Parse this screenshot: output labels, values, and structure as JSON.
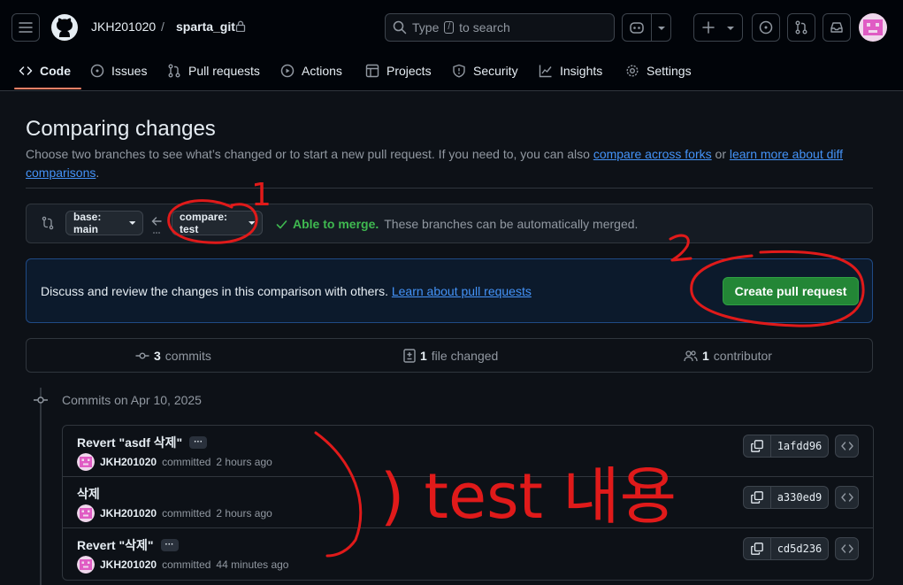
{
  "header": {
    "owner": "JKH201020",
    "separator": "/",
    "repo": "sparta_git",
    "search": {
      "prefix": "Type",
      "key": "/",
      "suffix": "to search"
    }
  },
  "tabs": [
    {
      "label": "Code",
      "icon": "code-icon"
    },
    {
      "label": "Issues",
      "icon": "issue-icon"
    },
    {
      "label": "Pull requests",
      "icon": "pull-request-icon"
    },
    {
      "label": "Actions",
      "icon": "play-icon"
    },
    {
      "label": "Projects",
      "icon": "table-icon"
    },
    {
      "label": "Security",
      "icon": "shield-icon"
    },
    {
      "label": "Insights",
      "icon": "graph-icon"
    },
    {
      "label": "Settings",
      "icon": "gear-icon"
    }
  ],
  "page": {
    "title": "Comparing changes",
    "desc_text": "Choose two branches to see what’s changed or to start a new pull request. If you need to, you can also ",
    "link_forks": "compare across forks",
    "desc_or": " or ",
    "link_learn": "learn more about diff comparisons",
    "desc_end": "."
  },
  "range": {
    "base_label": "base: main",
    "compare_label": "compare: test",
    "merge_status": "Able to merge.",
    "merge_desc": "These branches can be automatically merged."
  },
  "pr_banner": {
    "text": "Discuss and review the changes in this comparison with others.",
    "link": "Learn about pull requests",
    "button": "Create pull request"
  },
  "stats": {
    "commits_count": "3",
    "commits_label": "commits",
    "files_count": "1",
    "files_label": "file changed",
    "contrib_count": "1",
    "contrib_label": "contributor"
  },
  "commit_group": {
    "date": "Commits on Apr 10, 2025"
  },
  "commits": [
    {
      "message": "Revert \"asdf 삭제\"",
      "author": "JKH201020",
      "verb": "committed",
      "time": "2 hours ago",
      "sha": "1afdd96",
      "has_ellipsis": true
    },
    {
      "message": "삭제",
      "author": "JKH201020",
      "verb": "committed",
      "time": "2 hours ago",
      "sha": "a330ed9",
      "has_ellipsis": false
    },
    {
      "message": "Revert \"삭제\"",
      "author": "JKH201020",
      "verb": "committed",
      "time": "44 minutes ago",
      "sha": "cd5d236",
      "has_ellipsis": true
    }
  ],
  "annotations": {
    "color": "#e01a1a",
    "mark1": "1",
    "mark2": "2",
    "handwriting": ") test 내용"
  },
  "colors": {
    "accent": "#4493f8",
    "success": "#3fb950",
    "primary_button": "#238636",
    "avatar": "#e05cc4"
  }
}
